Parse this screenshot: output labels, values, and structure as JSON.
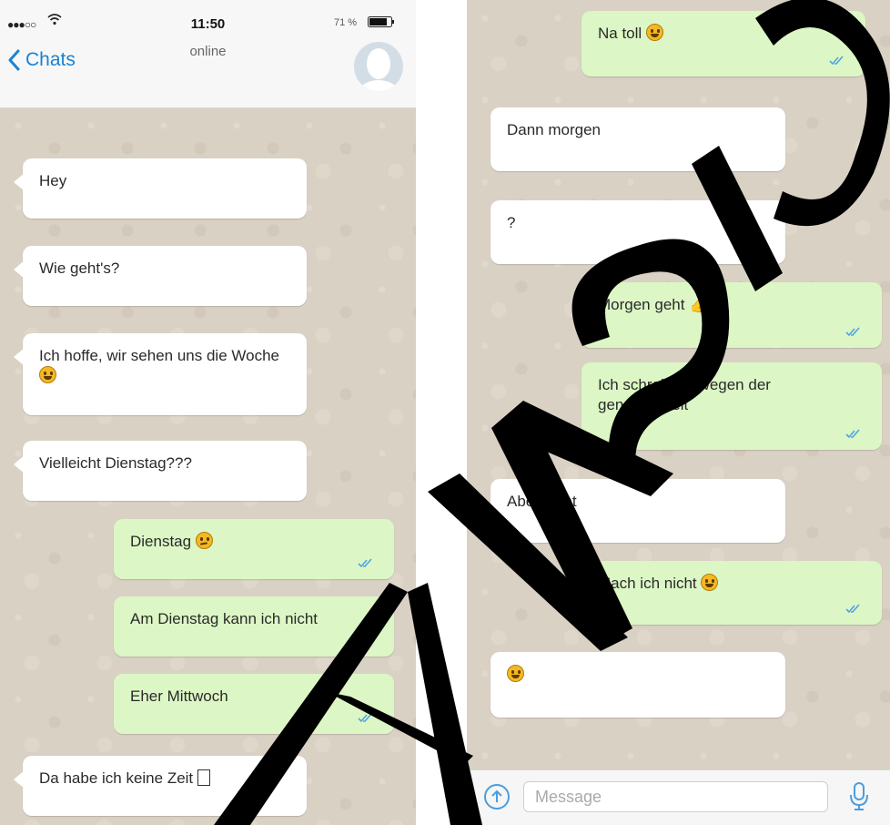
{
  "left": {
    "status_bar": {
      "signal": "●●●○○",
      "time": "11:50",
      "battery_text": "71 %"
    },
    "header": {
      "back_label": "Chats",
      "status": "online"
    },
    "messages": [
      {
        "dir": "in",
        "text": "Hey"
      },
      {
        "dir": "in",
        "text": "Wie geht's?"
      },
      {
        "dir": "in",
        "text": "Ich hoffe, wir sehen uns die Woche"
      },
      {
        "dir": "in",
        "text": "Vielleicht Dienstag???"
      },
      {
        "dir": "out",
        "text": "Dienstag"
      },
      {
        "dir": "out",
        "text": "Am Dienstag kann ich nicht"
      },
      {
        "dir": "out",
        "text": "Eher Mittwoch"
      },
      {
        "dir": "in",
        "text": "Da habe ich keine Zeit"
      }
    ]
  },
  "right": {
    "messages": [
      {
        "dir": "out",
        "text": "Na toll"
      },
      {
        "dir": "in",
        "text": "Dann morgen"
      },
      {
        "dir": "in",
        "text": "?"
      },
      {
        "dir": "out",
        "text": "Morgen geht"
      },
      {
        "dir": "out",
        "text": "Ich schreib dir wegen der genauen Zeit"
      },
      {
        "dir": "in",
        "text": "Aber nicht"
      },
      {
        "dir": "out",
        "text": "Mach ich nicht"
      },
      {
        "dir": "in",
        "text": ""
      }
    ],
    "input": {
      "placeholder": "Message"
    }
  },
  "colors": {
    "accent": "#1a82d4",
    "incoming": "#ffffff",
    "outgoing": "#dcf7c5",
    "check": "#4fa3e0",
    "chat_background": "#d9d1c3"
  },
  "icons": {
    "back": "chevron-left-icon",
    "avatar": "default-avatar-icon",
    "attach": "attach-icon",
    "mic": "microphone-icon",
    "read": "double-check-icon"
  }
}
